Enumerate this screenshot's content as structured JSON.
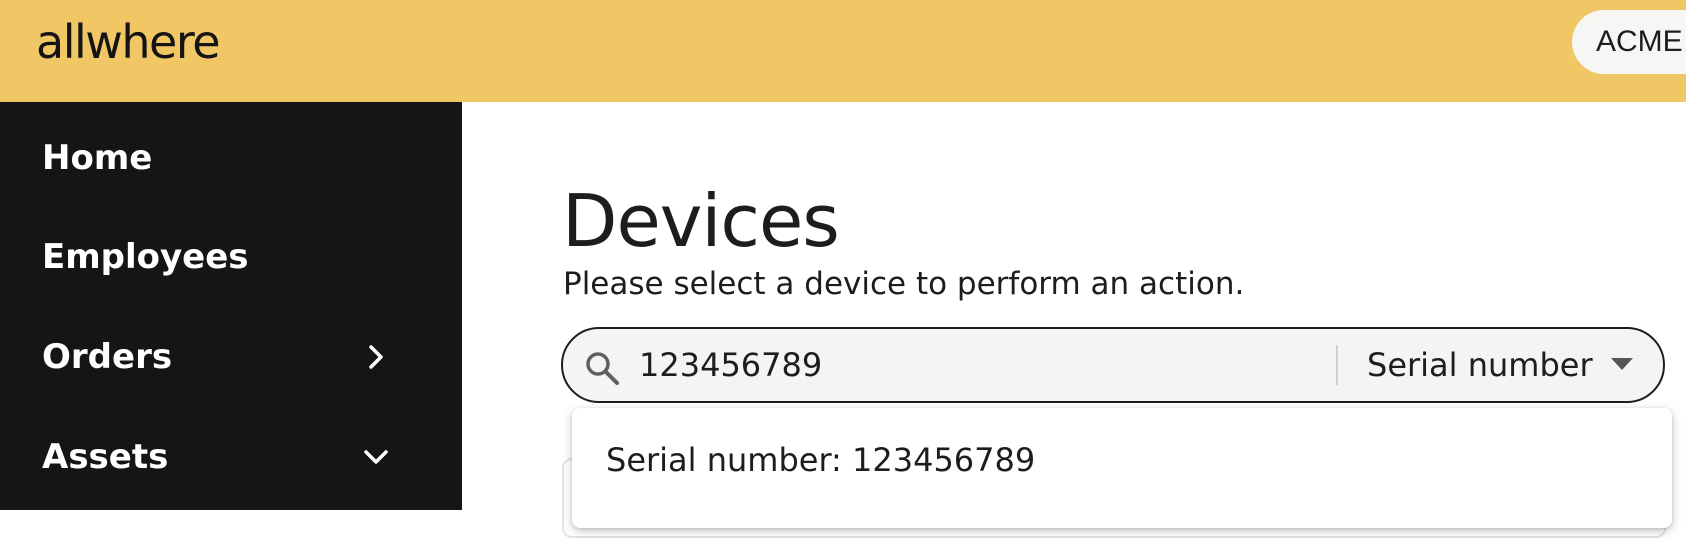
{
  "header": {
    "logo": "allwhere",
    "org_name": "ACME",
    "background_color": "#f1c665"
  },
  "sidebar": {
    "background_color": "#141616",
    "items": [
      {
        "label": "Home",
        "icon": ""
      },
      {
        "label": "Employees",
        "icon": ""
      },
      {
        "label": "Orders",
        "icon": "chevron-right-icon"
      },
      {
        "label": "Assets",
        "icon": "chevron-down-icon"
      }
    ]
  },
  "main": {
    "title": "Devices",
    "subtitle": "Please select a device to perform an action.",
    "search": {
      "value": "123456789",
      "icon": "search-icon",
      "filter": {
        "selected": "Serial number",
        "icon": "dropdown-arrow-icon"
      }
    },
    "suggestions": [
      {
        "text": "Serial number: 123456789"
      }
    ]
  }
}
